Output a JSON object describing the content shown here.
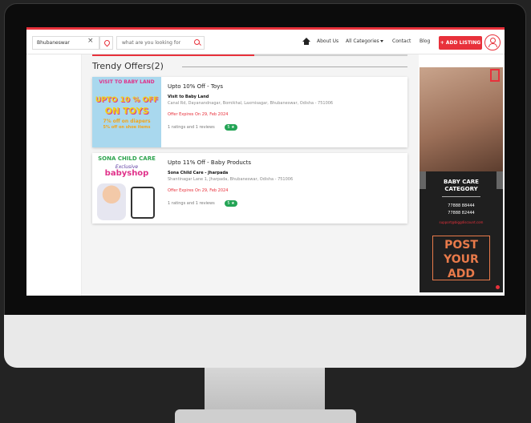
{
  "header": {
    "location_value": "Bhubaneswar",
    "search_placeholder": "what are you looking for",
    "nav": [
      "About Us",
      "All Categories",
      "Contact",
      "Blog"
    ],
    "add_listing_label": "+ ADD LISTING"
  },
  "main": {
    "section_title": "Trendy Offers(2)",
    "offers": [
      {
        "title": "Upto 10% Off - Toys",
        "name": "Visit to Baby Land",
        "address": "Canal Rd, Dayanandnagar, Bomikhal, Laxmisagar, Bhubaneswar, Odisha - 751006",
        "expires": "Offer Expires On 29, Feb 2024",
        "reviews": "1 ratings and 1 reviews",
        "rating": "5 ★",
        "image_text": {
          "top": "VISIT TO BABY LAND",
          "line1": "UPTO 10 % OFF",
          "line2": "ON TOYS",
          "line3": "7% off on diapers",
          "line4": "5% off on shoe items"
        }
      },
      {
        "title": "Upto 11% Off - Baby Products",
        "name": "Sona Child Care - Jharpada",
        "address": "Shantinagar Lane 1, Jharpada, Bhubaneswar, Odisha - 751006",
        "expires": "Offer Expires On 29, Feb 2024",
        "reviews": "1 ratings and 1 reviews",
        "rating": "5 ★",
        "image_text": {
          "top": "SONA CHILD CARE",
          "line1": "Exclusive",
          "line2": "babyshop"
        }
      }
    ]
  },
  "ad": {
    "line1": "BABY CARE",
    "line2": "CATEGORY",
    "phone1": "77888 88444",
    "phone2": "77888 82444",
    "email": "support@biggdiscount.com",
    "post_lines": [
      "POST",
      "YOUR",
      "ADD"
    ]
  },
  "colors": {
    "accent": "#e8313b",
    "rating_green": "#23a455"
  }
}
